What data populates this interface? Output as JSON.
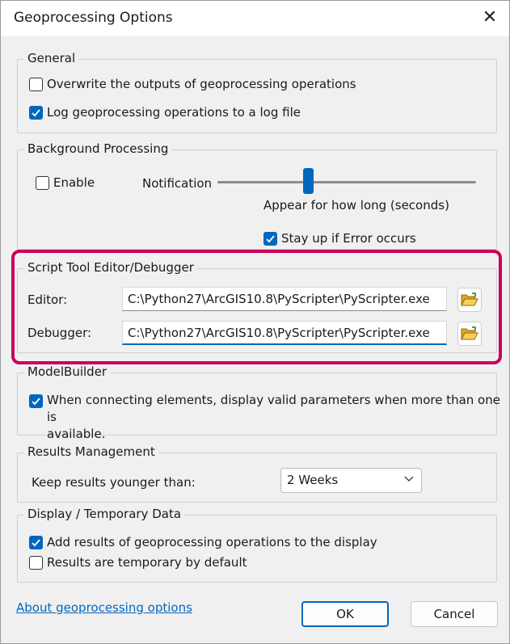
{
  "window": {
    "title": "Geoprocessing Options",
    "close_glyph": "✕"
  },
  "general": {
    "legend": "General",
    "overwrite": {
      "label": "Overwrite the outputs of geoprocessing operations",
      "checked": false
    },
    "log": {
      "label": "Log geoprocessing operations to a log file",
      "checked": true
    }
  },
  "background": {
    "legend": "Background Processing",
    "enable": {
      "label": "Enable",
      "checked": false
    },
    "notification_label": "Notification",
    "slider_caption": "Appear for how long (seconds)",
    "slider_level": 0.35,
    "stay_up": {
      "label": "Stay up if Error occurs",
      "checked": true
    }
  },
  "script_tool": {
    "legend": "Script Tool Editor/Debugger",
    "editor_label": "Editor:",
    "editor_value": "C:\\Python27\\ArcGIS10.8\\PyScripter\\PyScripter.exe",
    "debugger_label": "Debugger:",
    "debugger_value": "C:\\Python27\\ArcGIS10.8\\PyScripter\\PyScripter.exe"
  },
  "modelbuilder": {
    "legend": "ModelBuilder",
    "valid_params": {
      "label_line1": "When connecting elements, display valid parameters when more than one is",
      "label_line2": "available.",
      "checked": true
    }
  },
  "results": {
    "legend": "Results Management",
    "keep_label": "Keep results younger than:",
    "keep_value": "2 Weeks"
  },
  "display": {
    "legend": "Display / Temporary Data",
    "add_results": {
      "label": "Add results of geoprocessing operations to the display",
      "checked": true
    },
    "temporary": {
      "label": "Results are temporary by default",
      "checked": false
    }
  },
  "footer": {
    "about_link": "About geoprocessing options",
    "ok_label": "OK",
    "cancel_label": "Cancel"
  },
  "colors": {
    "accent": "#0067c0",
    "highlight": "#c8005f"
  }
}
